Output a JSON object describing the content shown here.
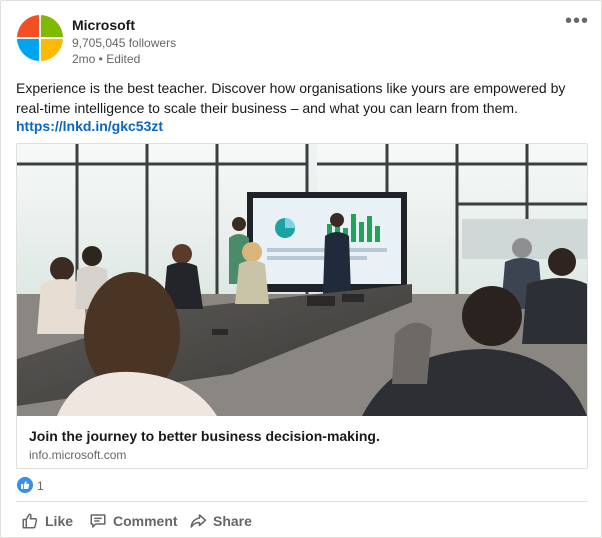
{
  "post": {
    "company_name": "Microsoft",
    "followers": "9,705,045 followers",
    "meta": "2mo • Edited",
    "more_label": "•••",
    "text": "Experience is the best teacher. Discover how organisations like yours are empowered by real-time intelligence to scale their business – and what you can learn from them.",
    "link": "https://lnkd.in/gkc53zt",
    "logo_colors": [
      "#f25022",
      "#7fba00",
      "#00a4ef",
      "#ffb900"
    ]
  },
  "card": {
    "image_icon": "meeting-room-photo",
    "title": "Join the journey to better business decision-making.",
    "domain": "info.microsoft.com"
  },
  "social": {
    "reaction_icon": "like-icon",
    "reaction_count": "1"
  },
  "actions": [
    {
      "label": "Like",
      "icon": "thumbs-up-icon"
    },
    {
      "label": "Comment",
      "icon": "comment-icon"
    },
    {
      "label": "Share",
      "icon": "share-icon"
    }
  ],
  "colors": {
    "link": "#0a66c2",
    "secondary_text": "#666666"
  }
}
